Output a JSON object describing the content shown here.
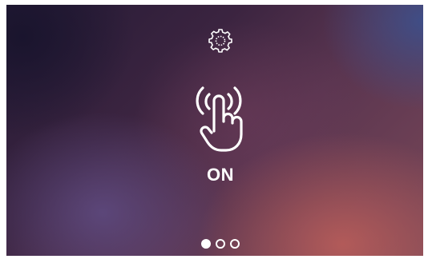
{
  "screen": {
    "icons": {
      "settings": "gear-icon",
      "touch": "hand-tap-icon"
    },
    "status_label": "ON",
    "pager": {
      "total": 3,
      "current": 1
    },
    "colors": {
      "foreground": "#ffffff",
      "background_top_left": "#241a35",
      "background_bottom_right": "#b85a56"
    }
  }
}
